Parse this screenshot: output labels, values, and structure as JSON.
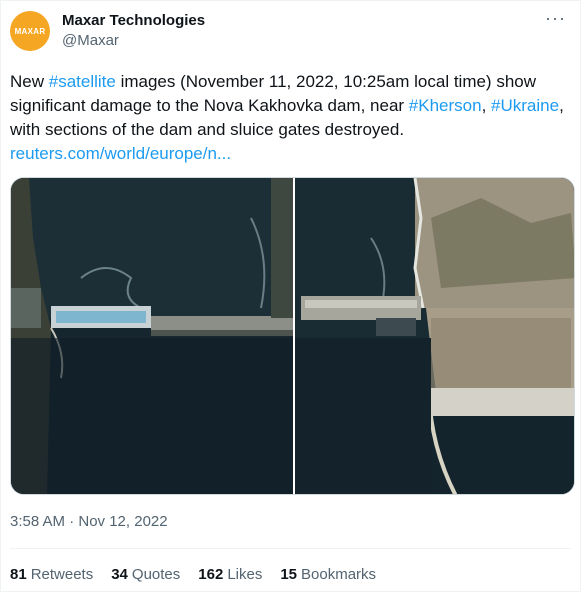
{
  "author": {
    "display_name": "Maxar Technologies",
    "handle": "@Maxar",
    "avatar_text": "MAXAR",
    "avatar_color": "#f5a623"
  },
  "tweet": {
    "text_parts": {
      "p1": "New ",
      "hashtag1": "#satellite",
      "p2": " images (November 11, 2022, 10:25am local time) show significant damage to the Nova Kakhovka dam, near ",
      "hashtag2": "#Kherson",
      "p3": ", ",
      "hashtag3": "#Ukraine",
      "p4": ", with sections of the dam and sluice gates destroyed.",
      "link": "reuters.com/world/europe/n..."
    },
    "timestamp": "3:58 AM · Nov 12, 2022"
  },
  "stats": {
    "retweets_count": "81",
    "retweets_label": "Retweets",
    "quotes_count": "34",
    "quotes_label": "Quotes",
    "likes_count": "162",
    "likes_label": "Likes",
    "bookmarks_count": "15",
    "bookmarks_label": "Bookmarks"
  },
  "icons": {
    "more": "more-options-icon"
  },
  "colors": {
    "link": "#1d9bf0",
    "text": "#0f1419",
    "muted": "#536471"
  }
}
